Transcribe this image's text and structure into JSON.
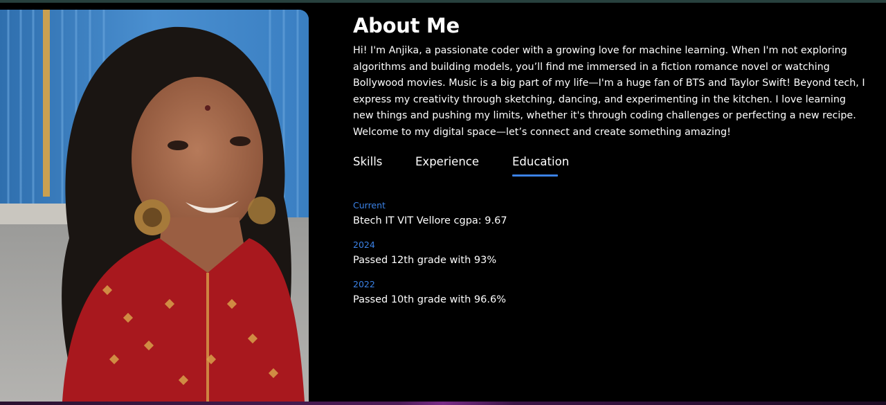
{
  "about": {
    "title": "About Me",
    "bio_lines": [
      "Hi! I'm Anjika, a passionate coder with a growing love for machine learning. When I'm not exploring",
      "algorithms and building models, you’ll find me immersed in a fiction romance novel or watching",
      "Bollywood movies. Music is a big part of my life—I'm a huge fan of BTS and Taylor Swift! Beyond tech, I",
      "express my creativity through sketching, dancing, and experimenting in the kitchen. I love learning",
      "new things and pushing my limits, whether it's through coding challenges or perfecting a new recipe.",
      "Welcome to my digital space—let’s connect and create something amazing!"
    ]
  },
  "tabs": [
    {
      "label": "Skills",
      "active": false
    },
    {
      "label": "Experience",
      "active": false
    },
    {
      "label": "Education",
      "active": true
    }
  ],
  "education": [
    {
      "year": "Current",
      "detail": "Btech IT VIT Vellore cgpa: 9.67"
    },
    {
      "year": "2024",
      "detail": "Passed 12th grade with 93%"
    },
    {
      "year": "2022",
      "detail": "Passed 10th grade with 96.6%"
    }
  ],
  "colors": {
    "background": "#000000",
    "accent": "#3b82e6",
    "text": "#ffffff"
  }
}
